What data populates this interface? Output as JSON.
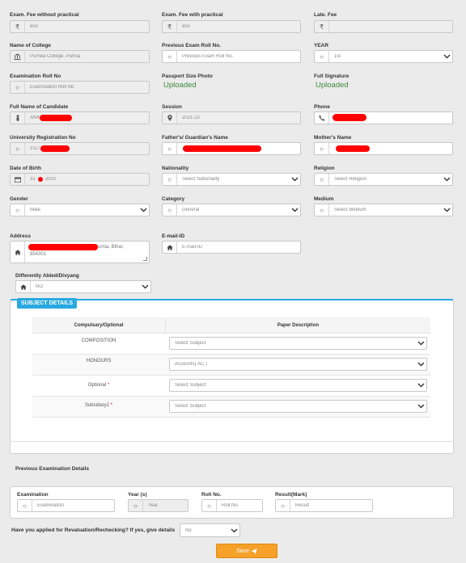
{
  "fees": {
    "without_practical_label": "Exam. Fee without practical",
    "without_practical_value": "650",
    "with_practical_label": "Exam. Fee with practical",
    "with_practical_value": "850",
    "late_label": "Late. Fee",
    "late_value": "",
    "currency": "₹"
  },
  "college": {
    "label": "Name of College",
    "value": "Purnea College, Purnia"
  },
  "prev_roll": {
    "label": "Previous Exam Roll No.",
    "placeholder": "Previous Exam Roll No."
  },
  "year": {
    "label": "YEAR",
    "value": "1st"
  },
  "exam_roll": {
    "label": "Examination Roll No",
    "placeholder": "Examination Roll No"
  },
  "photo": {
    "label": "Passport Size Photo",
    "status": "Uploaded"
  },
  "signature": {
    "label": "Full Signature",
    "status": "Uploaded"
  },
  "full_name": {
    "label": "Full Name of Candidate",
    "value": "ANK"
  },
  "session": {
    "label": "Session",
    "value": "2021-22"
  },
  "phone": {
    "label": "Phone",
    "value": ""
  },
  "reg_no": {
    "label": "University Registration No",
    "value": "2117"
  },
  "father": {
    "label": "Father's/ Guardian's Name",
    "value": ""
  },
  "mother": {
    "label": "Mother's Name",
    "value": ""
  },
  "dob": {
    "label": "Date of Birth",
    "value_prefix": "31",
    "value_suffix": "2002"
  },
  "nationality": {
    "label": "Nationality",
    "value": "Select Nationality"
  },
  "religion": {
    "label": "Religion",
    "value": "Select Religion"
  },
  "gender": {
    "label": "Gender",
    "value": "Male"
  },
  "category": {
    "label": "Category",
    "value": "General"
  },
  "medium": {
    "label": "Medium",
    "value": "Select Medium"
  },
  "address": {
    "label": "Address",
    "line1_tail": "Purnia, Bihar,",
    "line2": "854301"
  },
  "email": {
    "label": "E-mail-ID",
    "placeholder": "E-mail-ID"
  },
  "divyang": {
    "label": "Differently Abled/Divyang",
    "value": "NO"
  },
  "subject": {
    "title": "SUBJECT DETAILS",
    "col1": "Compulsary/Optional",
    "col2": "Paper Description",
    "rows": [
      {
        "type": "COMPOSITION",
        "required": "",
        "value": "Select Subject"
      },
      {
        "type": "HONOURS",
        "required": "",
        "value": "Accounts( AC )"
      },
      {
        "type": "Optional",
        "required": "*",
        "value": "Select Subject"
      },
      {
        "type": "Subsidary2",
        "required": "*",
        "value": "Select Subject"
      }
    ]
  },
  "prev_exam": {
    "title": "Previous Examination Details",
    "exam_label": "Examination",
    "exam_placeholder": "Examination",
    "year_label": "Year (s)",
    "year_placeholder": "Year",
    "roll_label": "Roll No.",
    "roll_placeholder": "Roll No",
    "result_label": "Result(Mark)",
    "result_placeholder": "Result"
  },
  "revaluation": {
    "label": "Have you applied for Revaluation/Rechecking? If yes, give details",
    "value": "No"
  },
  "save_label": "Save",
  "colors": {
    "accent": "#29a9e0",
    "uploaded": "#3c8a3c",
    "save": "#f5a12a",
    "redaction": "#ff0000"
  }
}
